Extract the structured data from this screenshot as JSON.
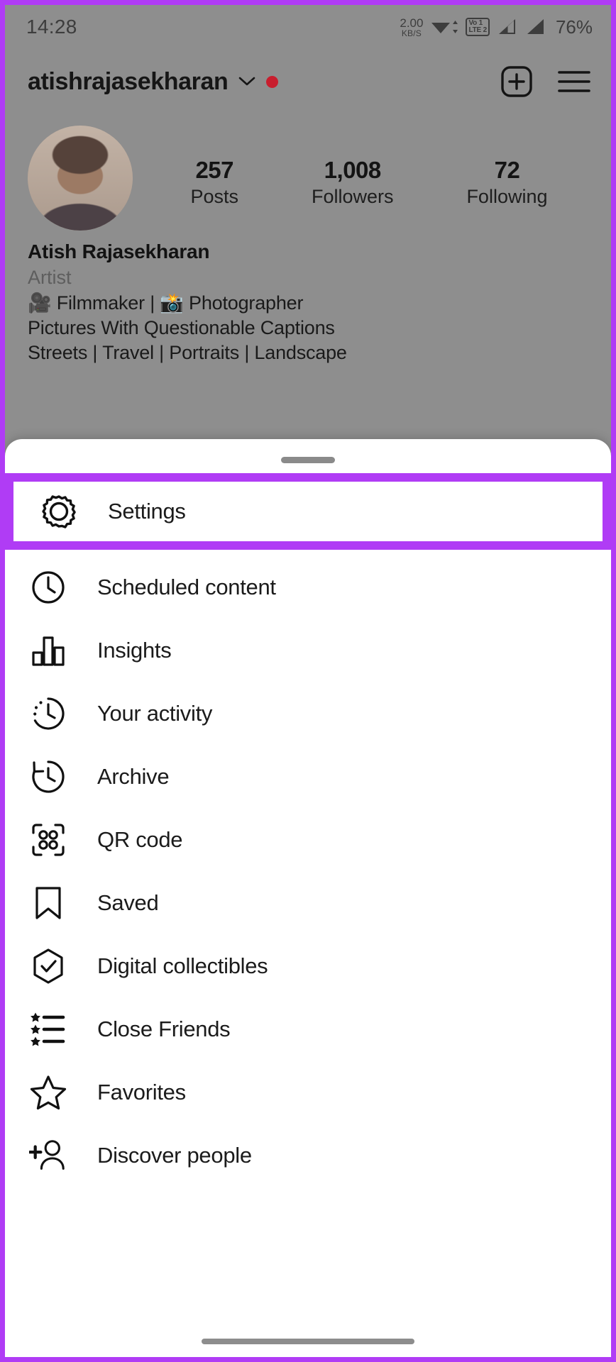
{
  "status_bar": {
    "time": "14:28",
    "net_speed_value": "2.00",
    "net_speed_unit": "KB/S",
    "wifi_icon": "wifi-icon",
    "volte_top": "Vo 1",
    "volte_bottom": "LTE 2",
    "signal_icon_1": "signal-bars-icon",
    "signal_icon_2": "signal-bars-icon",
    "battery": "76%"
  },
  "profile": {
    "username": "atishrajasekharan",
    "chevron_icon": "chevron-down-icon",
    "unread_badge": true,
    "create_icon": "plus-box-icon",
    "menu_icon": "hamburger-menu-icon",
    "avatar_icon": "profile-avatar",
    "stats": [
      {
        "value": "257",
        "label": "Posts"
      },
      {
        "value": "1,008",
        "label": "Followers"
      },
      {
        "value": "72",
        "label": "Following"
      }
    ],
    "full_name": "Atish Rajasekharan",
    "category": "Artist",
    "bio_lines": [
      "🎥 Filmmaker | 📸 Photographer",
      "Pictures With Questionable Captions",
      "Streets | Travel | Portraits | Landscape"
    ]
  },
  "sheet": {
    "grabber_name": "sheet-drag-handle",
    "highlight_color": "#b03cf5",
    "items": [
      {
        "label": "Settings",
        "icon": "gear-icon",
        "highlighted": true
      },
      {
        "label": "Scheduled content",
        "icon": "clock-icon",
        "highlighted": false
      },
      {
        "label": "Insights",
        "icon": "bar-chart-icon",
        "highlighted": false
      },
      {
        "label": "Your activity",
        "icon": "activity-clock-icon",
        "highlighted": false
      },
      {
        "label": "Archive",
        "icon": "archive-clock-back-icon",
        "highlighted": false
      },
      {
        "label": "QR code",
        "icon": "qr-code-icon",
        "highlighted": false
      },
      {
        "label": "Saved",
        "icon": "bookmark-icon",
        "highlighted": false
      },
      {
        "label": "Digital collectibles",
        "icon": "hexagon-check-icon",
        "highlighted": false
      },
      {
        "label": "Close Friends",
        "icon": "star-list-icon",
        "highlighted": false
      },
      {
        "label": "Favorites",
        "icon": "star-outline-icon",
        "highlighted": false
      },
      {
        "label": "Discover people",
        "icon": "add-person-icon",
        "highlighted": false
      }
    ]
  }
}
